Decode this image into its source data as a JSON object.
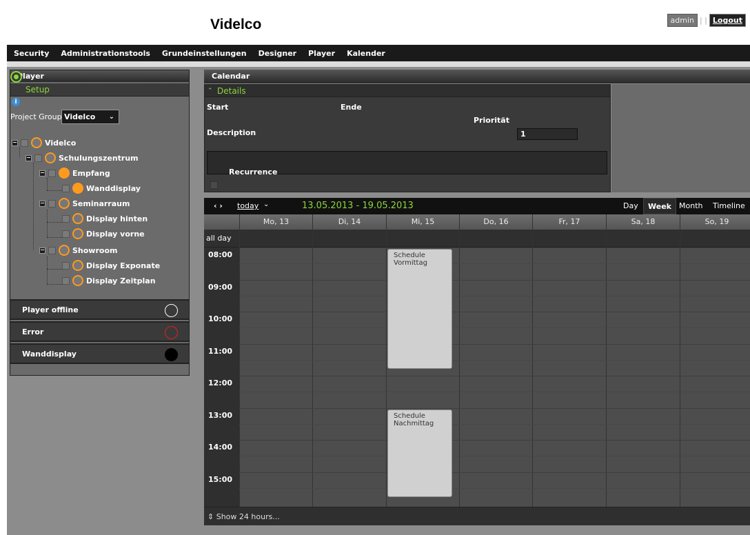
{
  "header": {
    "title": "Videlco",
    "user": "admin",
    "separator": "| |",
    "logout": "Logout"
  },
  "menu": [
    "Security",
    "Administrationstools",
    "Grundeinstellungen",
    "Designer",
    "Player",
    "Kalender"
  ],
  "player_panel": {
    "title": "Player",
    "setup": "Setup",
    "info": "i",
    "project_group_label": "Project Group",
    "project_group_value": "Videlco",
    "tree": [
      "Videlco",
      "Schulungszentrum",
      "Empfang",
      "Wanddisplay",
      "Seminarraum",
      "Display hinten",
      "Display vorne",
      "Showroom",
      "Display Exponate",
      "Display Zeitplan"
    ],
    "status": [
      "Player offline",
      "Error",
      "Wanddisplay"
    ]
  },
  "calendar": {
    "title": "Calendar",
    "details": {
      "title": "Details",
      "start": "Start",
      "end": "Ende",
      "priority_label": "Priorität",
      "priority_value": "1",
      "description": "Description",
      "recurrence": "Recurrence"
    },
    "toolbar": {
      "nav": "‹ ›",
      "today": "today",
      "range": "13.05.2013 - 19.05.2013",
      "views": [
        "Day",
        "Week",
        "Month",
        "Timeline"
      ],
      "active_view": "Week"
    },
    "days": [
      "Mo, 13",
      "Di, 14",
      "Mi, 15",
      "Do, 16",
      "Fr, 17",
      "Sa, 18",
      "So, 19"
    ],
    "all_day": "all day",
    "hours": [
      "08:00",
      "09:00",
      "10:00",
      "11:00",
      "12:00",
      "13:00",
      "14:00",
      "15:00"
    ],
    "events": [
      {
        "line1": "Schedule",
        "line2": "Vormittag",
        "day": "Mi, 15",
        "start": "08:00",
        "end": "12:00"
      },
      {
        "line1": "Schedule",
        "line2": "Nachmittag",
        "day": "Mi, 15",
        "start": "13:00",
        "end": "16:00"
      }
    ],
    "footer": "Show 24 hours..."
  },
  "colors": {
    "accent": "#8dd63a",
    "node": "#ff9a1f",
    "error": "#e02020"
  }
}
